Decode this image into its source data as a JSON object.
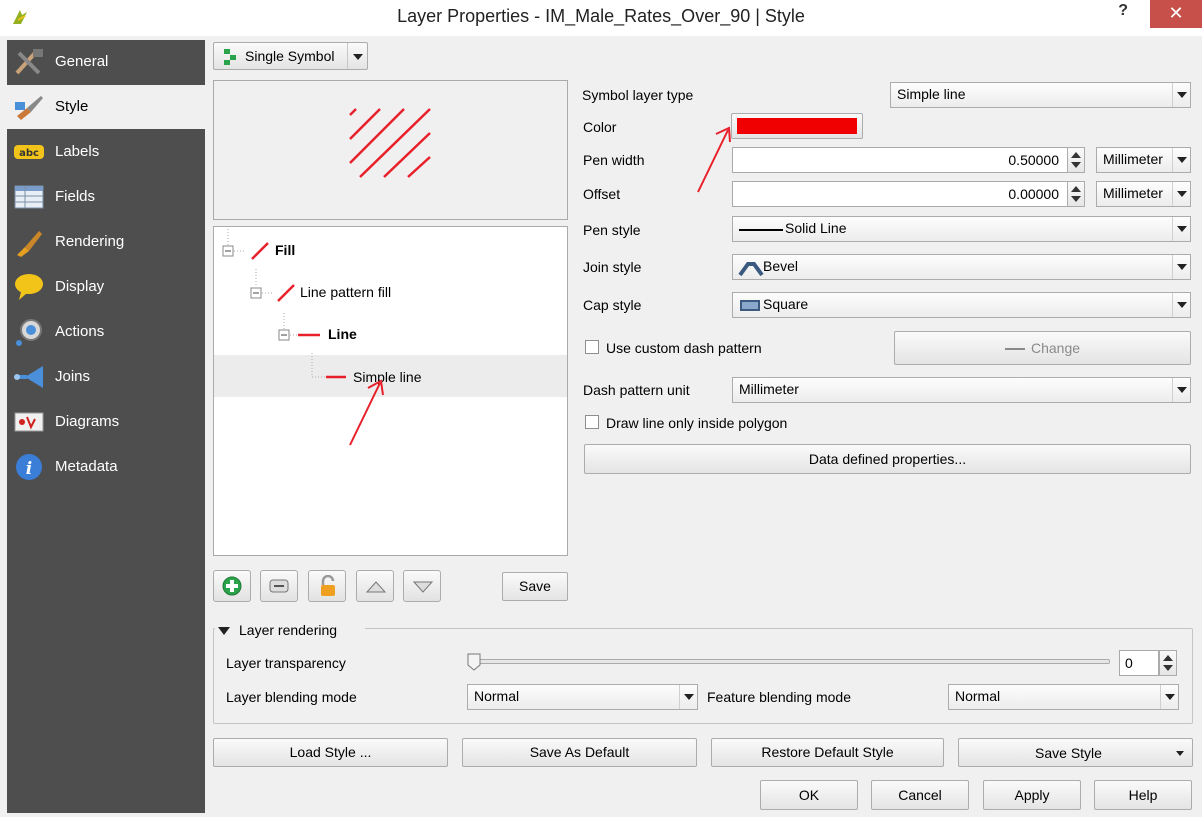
{
  "window": {
    "title": "Layer Properties - IM_Male_Rates_Over_90 | Style",
    "help": "?",
    "close": "✕"
  },
  "sidebar": {
    "items": [
      {
        "label": "General",
        "icon": "tools-icon"
      },
      {
        "label": "Style",
        "icon": "paintbrush-icon"
      },
      {
        "label": "Labels",
        "icon": "abc-label-icon"
      },
      {
        "label": "Fields",
        "icon": "table-icon"
      },
      {
        "label": "Rendering",
        "icon": "brush-icon"
      },
      {
        "label": "Display",
        "icon": "speech-bubble-icon"
      },
      {
        "label": "Actions",
        "icon": "gear-play-icon"
      },
      {
        "label": "Joins",
        "icon": "join-arrow-icon"
      },
      {
        "label": "Diagrams",
        "icon": "chart-icon"
      },
      {
        "label": "Metadata",
        "icon": "info-icon"
      }
    ]
  },
  "renderer": {
    "label": "Single Symbol"
  },
  "tree": {
    "fill": "Fill",
    "line_pattern_fill": "Line pattern fill",
    "line": "Line",
    "simple_line": "Simple line"
  },
  "tree_save": "Save",
  "props": {
    "symbol_layer_type_label": "Symbol layer type",
    "symbol_layer_type": "Simple line",
    "color_label": "Color",
    "color_value": "#f00000",
    "pen_width_label": "Pen width",
    "pen_width": "0.50000",
    "pen_width_unit": "Millimeter",
    "offset_label": "Offset",
    "offset": "0.00000",
    "offset_unit": "Millimeter",
    "pen_style_label": "Pen style",
    "pen_style": "Solid Line",
    "join_style_label": "Join style",
    "join_style": "Bevel",
    "cap_style_label": "Cap style",
    "cap_style": "Square",
    "custom_dash_label": "Use custom dash pattern",
    "change": "Change",
    "dash_unit_label": "Dash pattern unit",
    "dash_unit": "Millimeter",
    "draw_inside_label": "Draw line only inside polygon",
    "data_defined": "Data defined properties..."
  },
  "layer_rendering": {
    "title": "Layer rendering",
    "transparency_label": "Layer transparency",
    "transparency": "0",
    "blend_label": "Layer blending mode",
    "blend": "Normal",
    "feature_blend_label": "Feature blending mode",
    "feature_blend": "Normal"
  },
  "style_buttons": {
    "load": "Load Style ...",
    "save_default": "Save As Default",
    "restore": "Restore Default Style",
    "save_style": "Save Style"
  },
  "dialog_buttons": {
    "ok": "OK",
    "cancel": "Cancel",
    "apply": "Apply",
    "help": "Help"
  },
  "colors": {
    "accent_red": "#e8202a",
    "sidebar_bg": "#4e4e4e"
  }
}
